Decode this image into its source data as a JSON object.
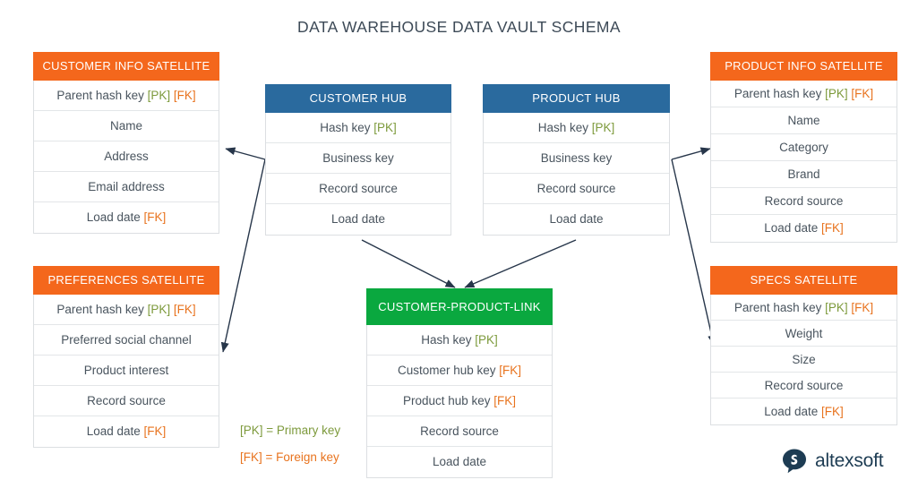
{
  "title": "DATA WAREHOUSE DATA VAULT SCHEMA",
  "key_tokens": {
    "pk": "[PK]",
    "fk": "[FK]"
  },
  "colors": {
    "satellite_header": "#f4671c",
    "hub_header": "#2a6a9e",
    "link_header": "#0aa83f",
    "primary_key": "#7d9a3c",
    "foreign_key": "#e8731e",
    "title_text": "#3d4a57",
    "row_text": "#49545e",
    "logo": "#1d3c53"
  },
  "entities": {
    "customer_info_satellite": {
      "title": "CUSTOMER INFO SATELLITE",
      "rows": [
        {
          "label": "Parent hash key",
          "pk": true,
          "fk": true
        },
        {
          "label": "Name",
          "pk": false,
          "fk": false
        },
        {
          "label": "Address",
          "pk": false,
          "fk": false
        },
        {
          "label": "Email address",
          "pk": false,
          "fk": false
        },
        {
          "label": "Load date",
          "pk": false,
          "fk": true
        }
      ]
    },
    "preferences_satellite": {
      "title": "PREFERENCES SATELLITE",
      "rows": [
        {
          "label": "Parent hash key",
          "pk": true,
          "fk": true
        },
        {
          "label": "Preferred social channel",
          "pk": false,
          "fk": false
        },
        {
          "label": "Product interest",
          "pk": false,
          "fk": false
        },
        {
          "label": "Record source",
          "pk": false,
          "fk": false
        },
        {
          "label": "Load date",
          "pk": false,
          "fk": true
        }
      ]
    },
    "customer_hub": {
      "title": "CUSTOMER HUB",
      "rows": [
        {
          "label": "Hash key",
          "pk": true,
          "fk": false
        },
        {
          "label": "Business key",
          "pk": false,
          "fk": false
        },
        {
          "label": "Record source",
          "pk": false,
          "fk": false
        },
        {
          "label": "Load date",
          "pk": false,
          "fk": false
        }
      ]
    },
    "product_hub": {
      "title": "PRODUCT HUB",
      "rows": [
        {
          "label": "Hash key",
          "pk": true,
          "fk": false
        },
        {
          "label": "Business key",
          "pk": false,
          "fk": false
        },
        {
          "label": "Record source",
          "pk": false,
          "fk": false
        },
        {
          "label": "Load date",
          "pk": false,
          "fk": false
        }
      ]
    },
    "customer_product_link": {
      "title": "CUSTOMER-PRODUCT-LINK",
      "rows": [
        {
          "label": "Hash key",
          "pk": true,
          "fk": false
        },
        {
          "label": "Customer hub key",
          "pk": false,
          "fk": true
        },
        {
          "label": "Product hub key",
          "pk": false,
          "fk": true
        },
        {
          "label": "Record source",
          "pk": false,
          "fk": false
        },
        {
          "label": "Load date",
          "pk": false,
          "fk": false
        }
      ]
    },
    "product_info_satellite": {
      "title": "PRODUCT INFO SATELLITE",
      "rows": [
        {
          "label": "Parent hash key",
          "pk": true,
          "fk": true
        },
        {
          "label": "Name",
          "pk": false,
          "fk": false
        },
        {
          "label": "Category",
          "pk": false,
          "fk": false
        },
        {
          "label": "Brand",
          "pk": false,
          "fk": false
        },
        {
          "label": "Record source",
          "pk": false,
          "fk": false
        },
        {
          "label": "Load date",
          "pk": false,
          "fk": true
        }
      ]
    },
    "specs_satellite": {
      "title": "SPECS SATELLITE",
      "rows": [
        {
          "label": "Parent hash key",
          "pk": true,
          "fk": true
        },
        {
          "label": "Weight",
          "pk": false,
          "fk": false
        },
        {
          "label": "Size",
          "pk": false,
          "fk": false
        },
        {
          "label": "Record source",
          "pk": false,
          "fk": false
        },
        {
          "label": "Load date",
          "pk": false,
          "fk": true
        }
      ]
    }
  },
  "legend": {
    "primary": {
      "token": "[PK]",
      "text": "= Primary key"
    },
    "foreign": {
      "token": "[FK]",
      "text": "= Foreign key"
    }
  },
  "logo": {
    "text": "altexsoft",
    "mark": "speech-bubble-s-icon"
  }
}
